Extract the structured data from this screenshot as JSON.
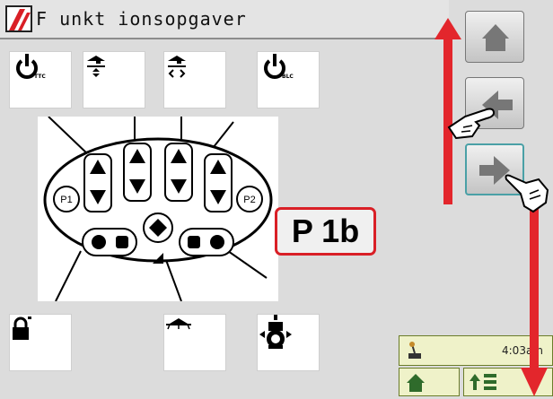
{
  "header": {
    "title": "F unkt ionsopgaver"
  },
  "function_tiles": [
    {
      "icon": "power-ttc-icon",
      "subscript": "TTC"
    },
    {
      "icon": "raise-lower-icon",
      "subscript": ""
    },
    {
      "icon": "raise-turn-icon",
      "subscript": ""
    },
    {
      "icon": "power-blc-icon",
      "subscript": "BLC"
    },
    {
      "icon": "lock-icon",
      "subscript": ""
    },
    {
      "icon": "boom-icon",
      "subscript": ""
    },
    {
      "icon": "tractor-icon",
      "subscript": ""
    }
  ],
  "keypad": {
    "p1_label": "P1",
    "p2_label": "P2"
  },
  "page_indicator": "P 1b",
  "status": {
    "time": "4:03am"
  },
  "colors": {
    "highlight": "#d91f26",
    "arrow": "#e3262c",
    "status_bg": "#eff2c9",
    "icon_green": "#2f6b2b"
  }
}
